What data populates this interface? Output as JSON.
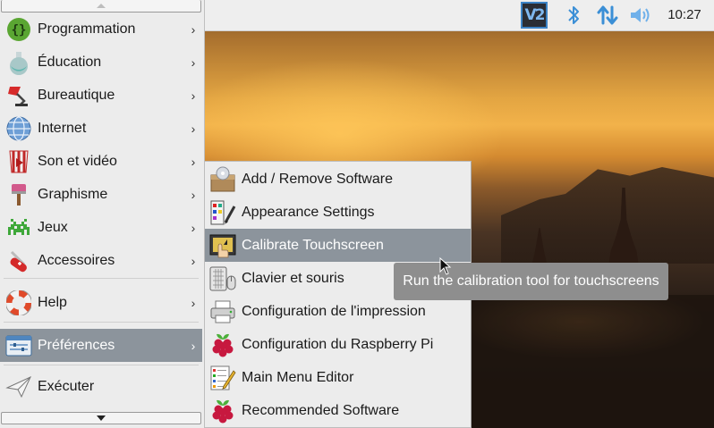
{
  "taskbar": {
    "vnc_label": "V2",
    "clock": "10:27",
    "icons": [
      "vnc-icon",
      "bluetooth-icon",
      "network-icon",
      "volume-icon"
    ]
  },
  "menu": {
    "items": [
      {
        "label": "Programmation",
        "icon": "programming-icon",
        "has_submenu": true
      },
      {
        "label": "Éducation",
        "icon": "education-flask-icon",
        "has_submenu": true
      },
      {
        "label": "Bureautique",
        "icon": "office-lamp-icon",
        "has_submenu": true
      },
      {
        "label": "Internet",
        "icon": "globe-icon",
        "has_submenu": true
      },
      {
        "label": "Son et vidéo",
        "icon": "sound-video-icon",
        "has_submenu": true
      },
      {
        "label": "Graphisme",
        "icon": "paintbrush-icon",
        "has_submenu": true
      },
      {
        "label": "Jeux",
        "icon": "games-invader-icon",
        "has_submenu": true
      },
      {
        "label": "Accessoires",
        "icon": "swiss-knife-icon",
        "has_submenu": true
      },
      {
        "label": "Help",
        "icon": "lifebuoy-icon",
        "has_submenu": true
      },
      {
        "label": "Préférences",
        "icon": "preferences-icon",
        "has_submenu": true,
        "selected": true
      },
      {
        "label": "Exécuter",
        "icon": "run-paperplane-icon",
        "has_submenu": false
      }
    ]
  },
  "submenu": {
    "items": [
      {
        "label": "Add / Remove Software",
        "icon": "package-icon"
      },
      {
        "label": "Appearance Settings",
        "icon": "appearance-icon"
      },
      {
        "label": "Calibrate Touchscreen",
        "icon": "touchscreen-icon",
        "selected": true
      },
      {
        "label": "Clavier et souris",
        "icon": "keyboard-mouse-icon"
      },
      {
        "label": "Configuration de l'impression",
        "icon": "printer-icon"
      },
      {
        "label": "Configuration du Raspberry Pi",
        "icon": "raspberry-icon"
      },
      {
        "label": "Main Menu Editor",
        "icon": "menu-editor-icon"
      },
      {
        "label": "Recommended Software",
        "icon": "raspberry-icon"
      }
    ]
  },
  "tooltip": {
    "text": "Run the calibration tool for touchscreens"
  },
  "colors": {
    "selection": "#8c949c",
    "menu_bg": "#ececec",
    "tooltip_bg": "#8e8e8e"
  }
}
